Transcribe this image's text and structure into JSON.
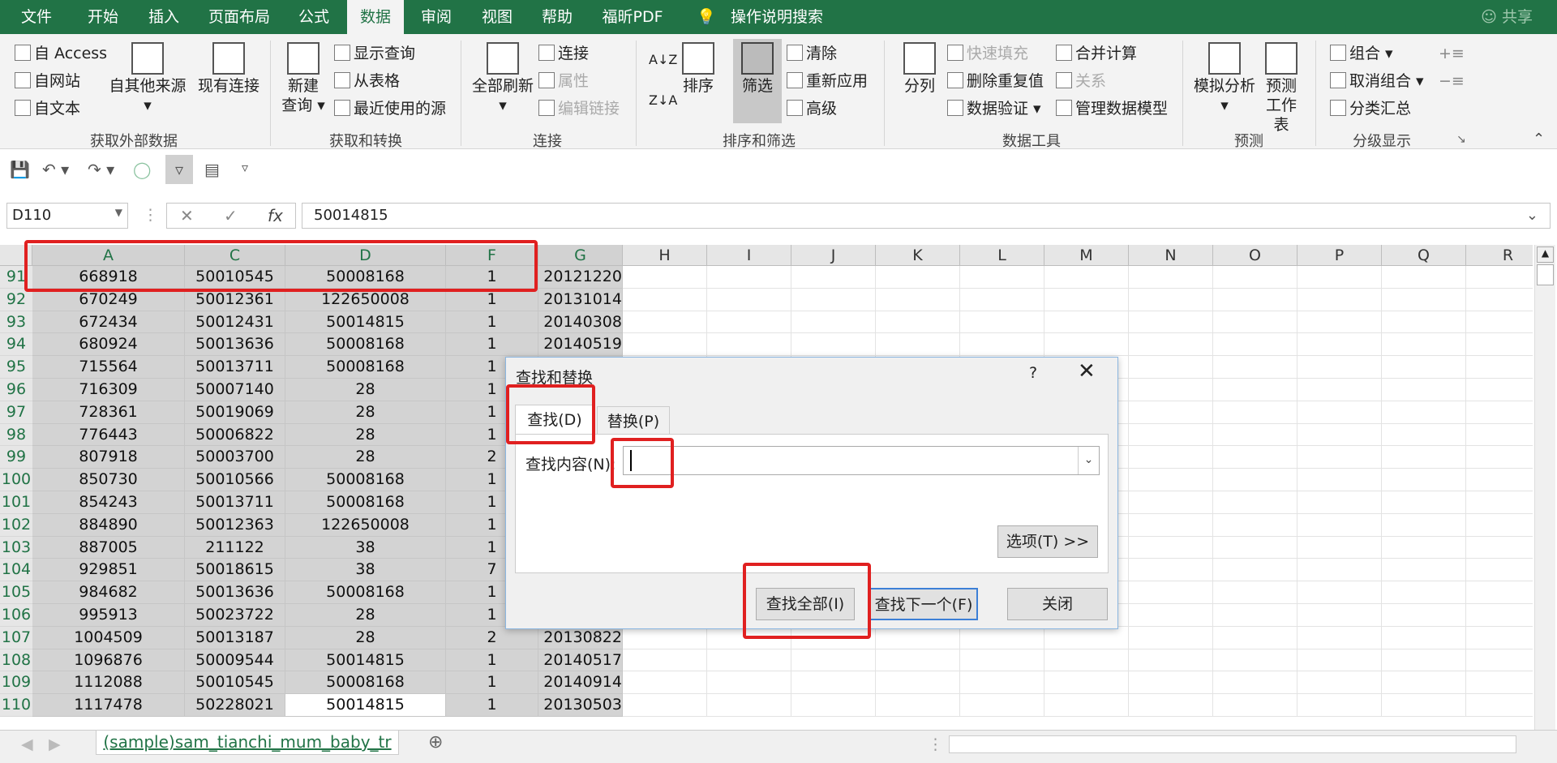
{
  "menu_tabs": [
    "文件",
    "开始",
    "插入",
    "页面布局",
    "公式",
    "数据",
    "审阅",
    "视图",
    "帮助",
    "福昕PDF",
    "操作说明搜索"
  ],
  "active_tab_index": 5,
  "share_label": "共享",
  "ribbon": {
    "ext": {
      "access": "自 Access",
      "web": "自网站",
      "text": "自文本",
      "other": "自其他来源",
      "existing": "现有连接",
      "group": "获取外部数据"
    },
    "transform": {
      "new_query_1": "新建",
      "new_query_2": "查询",
      "show_queries": "显示查询",
      "from_table": "从表格",
      "recent_sources": "最近使用的源",
      "group": "获取和转换"
    },
    "connections": {
      "refresh_all": "全部刷新",
      "connections": "连接",
      "properties": "属性",
      "edit_links": "编辑链接",
      "group": "连接"
    },
    "sort_filter": {
      "sort": "排序",
      "filter": "筛选",
      "clear": "清除",
      "reapply": "重新应用",
      "advanced": "高级",
      "group": "排序和筛选"
    },
    "data_tools": {
      "text_to_columns": "分列",
      "flash_fill": "快速填充",
      "remove_duplicates": "删除重复值",
      "data_validation": "数据验证",
      "consolidate": "合并计算",
      "relationships": "关系",
      "manage_model": "管理数据模型",
      "group": "数据工具"
    },
    "forecast": {
      "what_if": "模拟分析",
      "forecast_sheet_1": "预测",
      "forecast_sheet_2": "工作表",
      "group": "预测"
    },
    "outline": {
      "group_cmd": "组合",
      "ungroup": "取消组合",
      "subtotal": "分类汇总",
      "group": "分级显示"
    }
  },
  "namebox": "D110",
  "formula_value": "50014815",
  "columns": [
    "A",
    "C",
    "D",
    "F",
    "G",
    "H",
    "I",
    "J",
    "K",
    "L",
    "M",
    "N",
    "O",
    "P",
    "Q",
    "R"
  ],
  "rows": [
    {
      "n": "91",
      "A": "668918",
      "C": "50010545",
      "D": "50008168",
      "F": "1",
      "G": "20121220"
    },
    {
      "n": "92",
      "A": "670249",
      "C": "50012361",
      "D": "122650008",
      "F": "1",
      "G": "20131014"
    },
    {
      "n": "93",
      "A": "672434",
      "C": "50012431",
      "D": "50014815",
      "F": "1",
      "G": "20140308"
    },
    {
      "n": "94",
      "A": "680924",
      "C": "50013636",
      "D": "50008168",
      "F": "1",
      "G": "20140519"
    },
    {
      "n": "95",
      "A": "715564",
      "C": "50013711",
      "D": "50008168",
      "F": "1",
      "G": ""
    },
    {
      "n": "96",
      "A": "716309",
      "C": "50007140",
      "D": "28",
      "F": "1",
      "G": ""
    },
    {
      "n": "97",
      "A": "728361",
      "C": "50019069",
      "D": "28",
      "F": "1",
      "G": ""
    },
    {
      "n": "98",
      "A": "776443",
      "C": "50006822",
      "D": "28",
      "F": "1",
      "G": ""
    },
    {
      "n": "99",
      "A": "807918",
      "C": "50003700",
      "D": "28",
      "F": "2",
      "G": ""
    },
    {
      "n": "100",
      "A": "850730",
      "C": "50010566",
      "D": "50008168",
      "F": "1",
      "G": ""
    },
    {
      "n": "101",
      "A": "854243",
      "C": "50013711",
      "D": "50008168",
      "F": "1",
      "G": ""
    },
    {
      "n": "102",
      "A": "884890",
      "C": "50012363",
      "D": "122650008",
      "F": "1",
      "G": ""
    },
    {
      "n": "103",
      "A": "887005",
      "C": "211122",
      "D": "38",
      "F": "1",
      "G": ""
    },
    {
      "n": "104",
      "A": "929851",
      "C": "50018615",
      "D": "38",
      "F": "7",
      "G": ""
    },
    {
      "n": "105",
      "A": "984682",
      "C": "50013636",
      "D": "50008168",
      "F": "1",
      "G": ""
    },
    {
      "n": "106",
      "A": "995913",
      "C": "50023722",
      "D": "28",
      "F": "1",
      "G": ""
    },
    {
      "n": "107",
      "A": "1004509",
      "C": "50013187",
      "D": "28",
      "F": "2",
      "G": "20130822"
    },
    {
      "n": "108",
      "A": "1096876",
      "C": "50009544",
      "D": "50014815",
      "F": "1",
      "G": "20140517"
    },
    {
      "n": "109",
      "A": "1112088",
      "C": "50010545",
      "D": "50008168",
      "F": "1",
      "G": "20140914"
    },
    {
      "n": "110",
      "A": "1117478",
      "C": "50228021",
      "D": "50014815",
      "F": "1",
      "G": "20130503"
    }
  ],
  "sheet_tab": "(sample)sam_tianchi_mum_baby_tr",
  "dialog": {
    "title": "查找和替换",
    "help": "?",
    "tab_find": "查找(D)",
    "tab_replace": "替换(P)",
    "find_label": "查找内容(N):",
    "find_value": "",
    "options_btn": "选项(T) >>",
    "find_all_btn": "查找全部(I)",
    "find_next_btn": "查找下一个(F)",
    "close_btn": "关闭"
  }
}
